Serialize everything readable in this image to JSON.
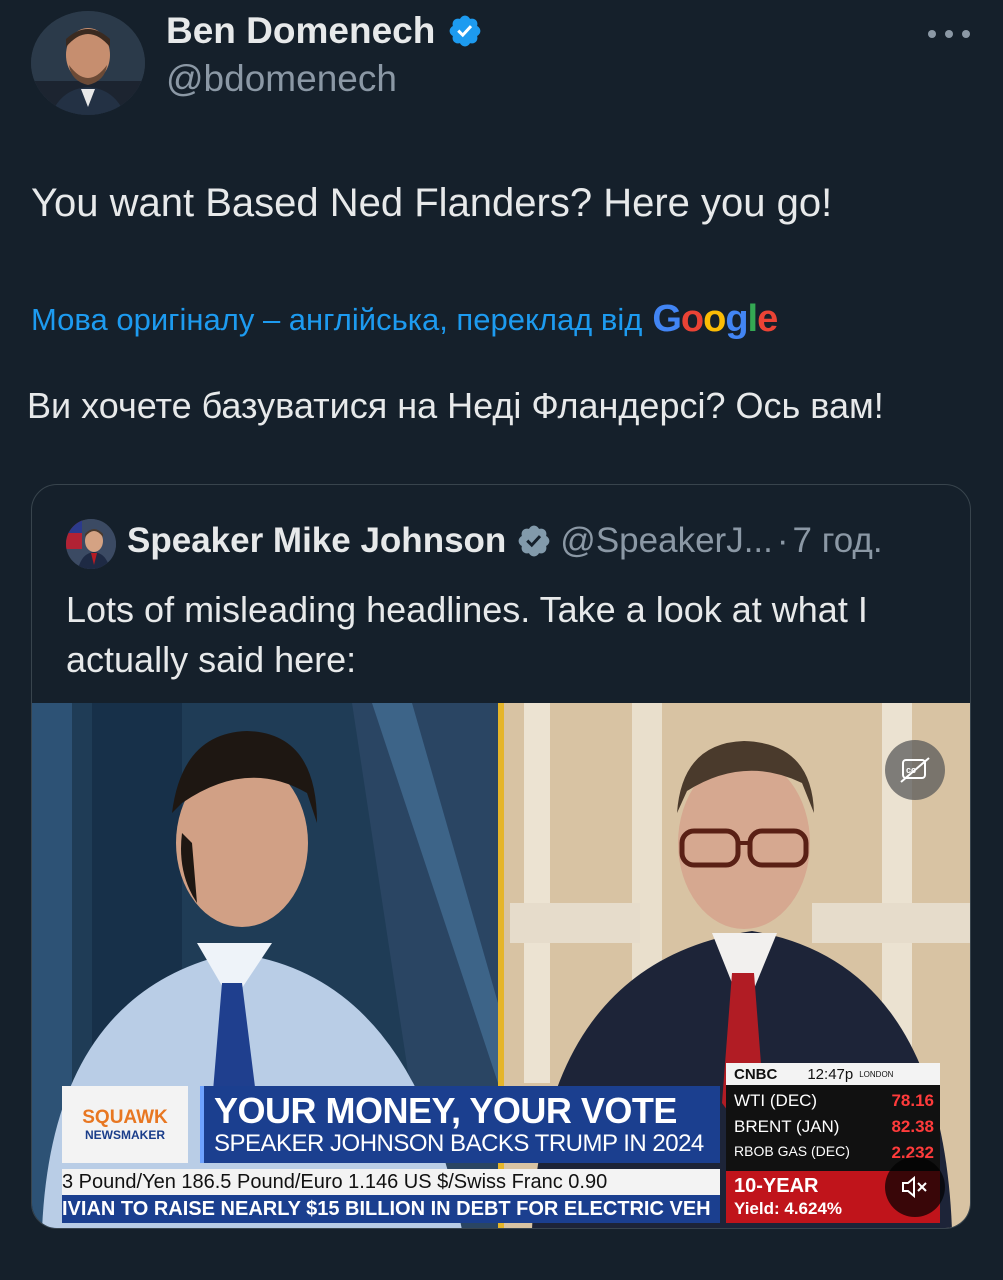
{
  "author": {
    "name": "Ben Domenech",
    "handle": "@bdomenech"
  },
  "tweet": {
    "text": "You want Based Ned Flanders? Here you go!",
    "translation_note": "Мова оригіналу – англійська, переклад від",
    "translation_provider": "Google",
    "translated_text": "Ви хочете базуватися на Неді Фландерсі? Ось вам!"
  },
  "quote": {
    "name": "Speaker Mike Johnson",
    "handle": "@SpeakerJ...",
    "time": "7 год.",
    "text": "Lots of misleading headlines. Take a look at what I actually said here:"
  },
  "video": {
    "squawk_line1": "SQUAWK",
    "squawk_line2": "NEWSMAKER",
    "headline": "YOUR MONEY, YOUR VOTE",
    "subheadline": "SPEAKER JOHNSON BACKS TRUMP IN 2024",
    "ticker_top": "3   Pound/Yen 186.5    Pound/Euro 1.146    US $/Swiss Franc 0.90",
    "ticker_bottom": "IVIAN TO RAISE NEARLY $15 BILLION IN DEBT FOR ELECTRIC VEH",
    "network": "CNBC",
    "clock": "12:47p",
    "clock_city": "LONDON",
    "markets": [
      {
        "label": "WTI  (DEC)",
        "value": "78.16"
      },
      {
        "label": "BRENT (JAN)",
        "value": "82.38"
      },
      {
        "label": "RBOB GAS (DEC)",
        "value": "2.232"
      }
    ],
    "treasury_label": "10-YEAR",
    "treasury_yield": "Yield: 4.624%"
  },
  "colors": {
    "background": "#15202b",
    "link": "#1d9bf0",
    "verified": "#1d9bf0",
    "muted": "#8b98a5"
  },
  "icons": [
    "verified-badge-icon",
    "more-icon",
    "closed-captions-icon",
    "muted-speaker-icon"
  ]
}
